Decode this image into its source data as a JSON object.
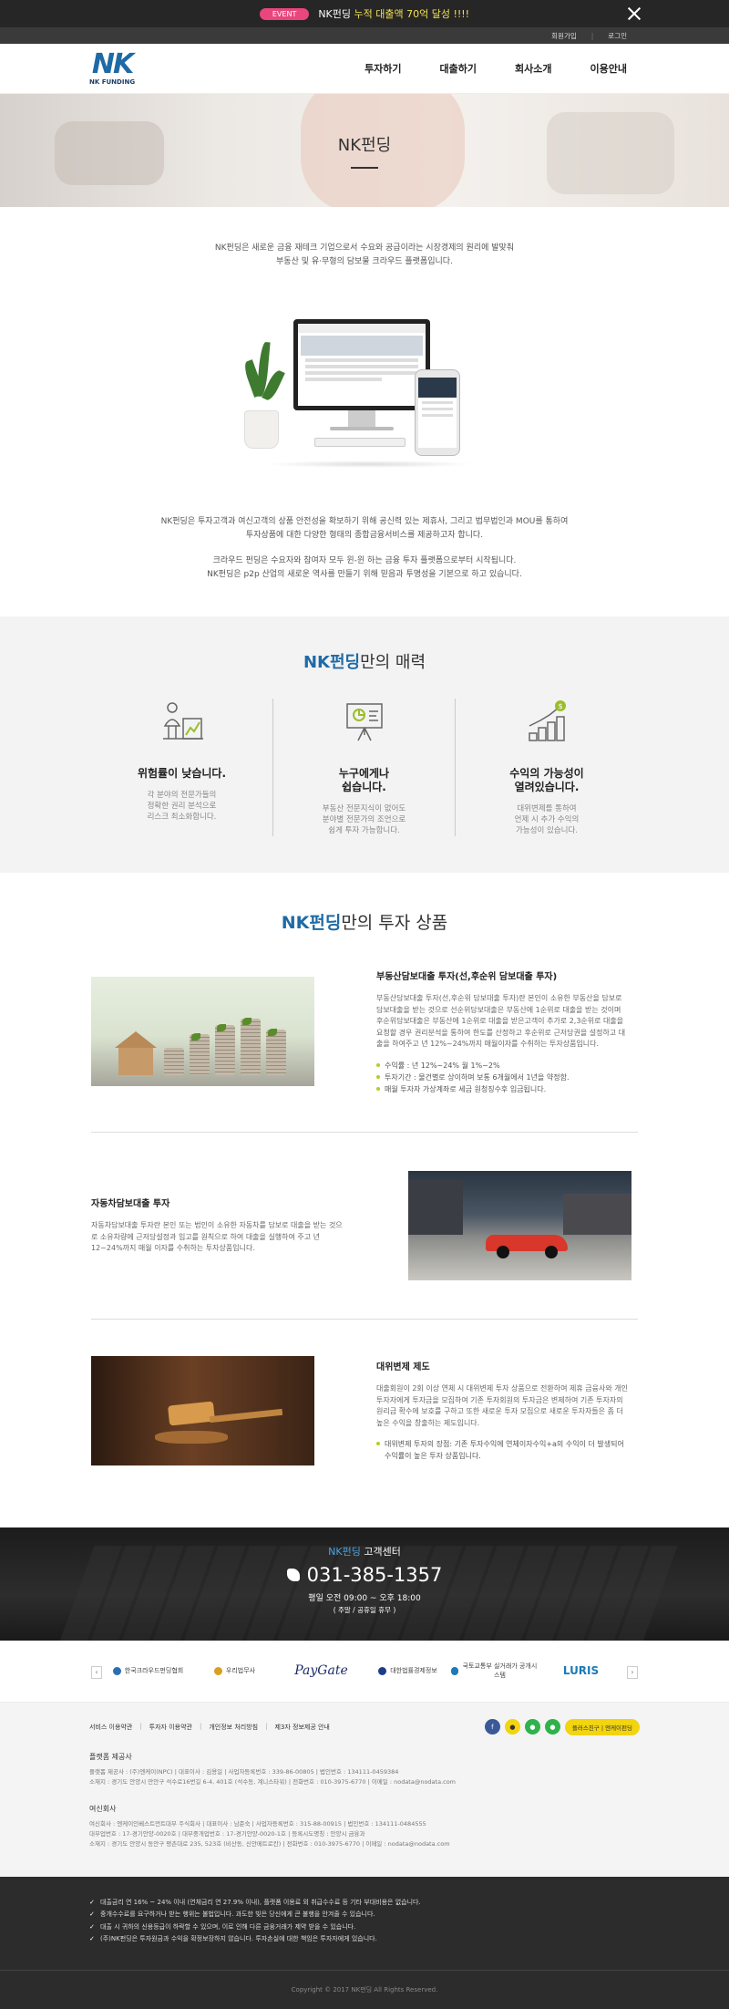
{
  "event": {
    "badge": "EVENT",
    "text_before": "NK펀딩 ",
    "text_highlight": "누적 대출액 70억 달성 !!!!"
  },
  "util": {
    "join": "회원가입",
    "login": "로그인"
  },
  "brand": {
    "logo_mark": "NK",
    "logo_sub": "NK FUNDING"
  },
  "nav": [
    "투자하기",
    "대출하기",
    "회사소개",
    "이용안내"
  ],
  "hero": {
    "title": "NK펀딩"
  },
  "intro": {
    "line1": "NK펀딩은 새로운 금융 재테크 기업으로서 수요와 공급이라는 시장경제의 원리에 발맞춰",
    "line2": "부동산 및 유·무형의 담보물 크라우드 플랫폼입니다.",
    "line3": "NK펀딩은 투자고객과 여신고객의 상품 안전성을 확보하기 위해 공신력 있는 제휴사, 그리고 법무법인과 MOU를 통하여",
    "line4": "투자상품에 대한 다양한 형태의 종합금융서비스를 제공하고자 합니다.",
    "line5": "크라우드 펀딩은 수요자와 참여자 모두 윈-윈 하는 금융 투자 플랫폼으로부터 시작됩니다.",
    "line6": "NK펀딩은 p2p 산업의 새로운 역사를 만들기 위해 믿음과 투명성을 기본으로 하고 있습니다."
  },
  "charm": {
    "title_blue": "NK펀딩",
    "title_rest": "만의 매력",
    "items": [
      {
        "icon": "investor-chart-icon",
        "head1": "위험률이 낮습니다.",
        "head2": "",
        "desc1": "각 분야의 전문가들의",
        "desc2": "정확한 권리 분석으로",
        "desc3": "리스크 최소화합니다."
      },
      {
        "icon": "presentation-board-icon",
        "head1": "누구에게나",
        "head2": "쉽습니다.",
        "desc1": "부동산 전문지식이 없어도",
        "desc2": "분야별 전문가의 조언으로",
        "desc3": "쉽게 투자 가능합니다."
      },
      {
        "icon": "growth-coins-icon",
        "head1": "수익의 가능성이",
        "head2": "열려있습니다.",
        "desc1": "대위변제를 통하여",
        "desc2": "언제 시 추가 수익의",
        "desc3": "가능성이 있습니다."
      }
    ]
  },
  "products": {
    "title_blue": "NK펀딩",
    "title_rest": "만의 투자 상품",
    "items": [
      {
        "name": "부동산담보대출 투자(선,후순위 담보대출 투자)",
        "desc": "부동산담보대출 투자(선,후순위 담보대출 투자)란 본인이 소유한 부동산을 담보로 담보대출을 받는 것으로 선순위담보대출은 부동산에 1순위로 대출을 받는 것이며 후순위담보대출은 부동산에 1순위로 대출을 받은고객이 추가로 2,3순위로 대출을 요청할 경우 권리분석을 통하여 한도를 산정하고 후순위로 근저당권을 설정하고 대출을 하여주고 년 12%~24%까지 매월이자를 수취하는 투자상품입니다.",
        "bullets": [
          "수익률 : 년 12%~24% 월 1%~2%",
          "투자기간 : 물건별로 상이하며 보통 6개월에서 1년을 약정함.",
          "매월 투자자 가상계좌로 세금 원청징수후 입금됩니다."
        ]
      },
      {
        "name": "자동차담보대출 투자",
        "desc": "자동차담보대출 투자란 본인 또는 법인이 소유한 자동차를 담보로 대출을 받는 것으로 소유차량에 근저당설정과 입고를 원칙으로 하여 대출을 실행하여 주고 년 12~24%까지 매월 이자를 수취하는 투자상품입니다.",
        "bullets": []
      },
      {
        "name": "대위변제 제도",
        "desc": "대출회원이 2회 이상 연체 시 대위변제 투자 상품으로 전환하여 제휴 금융사와 개인 투자자에게 투자금을 모집하여 기존 투자회원의 투자금은 변제하여 기존 투자자의 원리금 확수에 보호를 구하고 또한 새로운 투자 모집으로 새로운 투자자들은 좀 더 높은 수익을 창출하는 제도입니다.",
        "bullets": [
          "대위변제 투자의 장점: 기존 투자수익에 연체이자수익+a의 수익이 더 발생되어 수익률이 높은 투자 상품입니다."
        ]
      }
    ]
  },
  "cs": {
    "title_blue": "NK펀딩",
    "title_rest": " 고객센터",
    "phone": "031-385-1357",
    "hours": "평일 오전 09:00 ~ 오후 18:00",
    "closed": "( 주말 / 공휴일 휴무 )"
  },
  "partners": [
    "한국크라우드펀딩협회",
    "우리법무사",
    "PayGate",
    "대한법률경제정보",
    "국토교통부 실거래가 공개시스템",
    "LURIS"
  ],
  "footer": {
    "links": [
      "서비스 이용약관",
      "투자자 이용약관",
      "개인정보 처리방침",
      "제3자 정보제공 안내"
    ],
    "plusfriend": "플러스친구 | 엔케이펀딩",
    "platform_head": "플랫폼 제공사",
    "platform_line1": "플랫폼 제공사 : (주)엔케이(NPC) | 대표이사 : 김용일 | 사업자등록번호 : 339-86-00805 | 법인번호 : 134111-0459384",
    "platform_line2": "소재지 : 경기도 안양시 만안구 석수로16번길 6-4, 401호 (석수동, 계니스타워) | 전화번호 : 010-3975-6770 | 이메일 : nodata@nodata.com",
    "credit_head": "여신회사",
    "credit_line1": "여신회사 : 엔케이인베스트먼트대부 주식회사 | 대표이사 : 남준숙 | 사업자등록번호 : 315-88-00915 | 법인번호 : 134111-0484555",
    "credit_line2": "대부업번호 : 17-경기안양-0020호 | 대부중개업번호 : 17-경기안양-0020-1호 | 등록시도명칭 : 안양시 금융과",
    "credit_line3": "소재지 : 경기도 안양시 동안구 평촌대로 235, 523호 (비산동, 신안메트로칸) | 전화번호 : 010-3975-6770 | 이메일 : nodata@nodata.com"
  },
  "notice": [
    "대출금리 연 16% ~ 24% 이내 (연체금리 연 27.9% 이내), 플랫폼 이용료 외 취급수수료 등 기타 부대비용은 없습니다.",
    "중개수수료를 요구하거나 받는 행위는 불법입니다. 과도한 빚은 당신에게 큰 불행을 안겨줄 수 있습니다.",
    "대출 시 귀하의 신용등급이 하락할 수 있으며, 이로 인해 다른 금융거래가 제약 받을 수 있습니다.",
    "(주)NK펀딩은 투자원금과 수익을 확정보장하지 않습니다. 투자손실에 대한 책임은 투자자에게 있습니다."
  ],
  "copyright": "Copyright © 2017 NK펀딩 All Rights Reserved."
}
